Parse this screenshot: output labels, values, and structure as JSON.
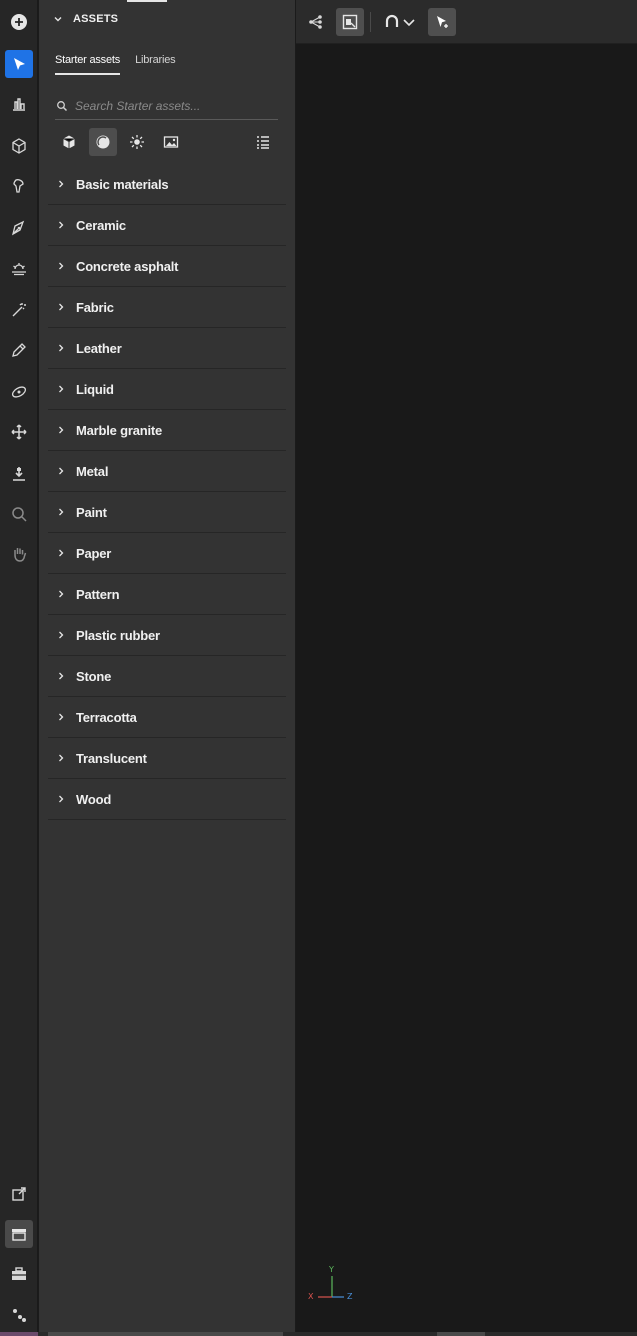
{
  "colors": {
    "accent": "#1f73e6",
    "rail_bg": "#262626",
    "panel_bg": "#333333",
    "viewport_bg": "#191919",
    "axis_x": "#d9534f",
    "axis_y": "#5cb85c",
    "axis_z": "#4a90d9"
  },
  "rail": {
    "tools": [
      {
        "icon": "add-circle-icon"
      },
      {
        "icon": "select-arrow-icon",
        "active": true
      },
      {
        "icon": "chart-bars-icon"
      },
      {
        "icon": "cube-icon"
      },
      {
        "icon": "paint-brush-icon"
      },
      {
        "icon": "pen-tool-icon"
      },
      {
        "icon": "light-horizon-icon"
      },
      {
        "icon": "magic-wand-icon"
      },
      {
        "icon": "eyedropper-icon"
      },
      {
        "icon": "orbit-icon"
      },
      {
        "icon": "move-icon"
      },
      {
        "icon": "drop-to-ground-icon"
      },
      {
        "icon": "zoom-icon"
      },
      {
        "icon": "hand-pan-icon"
      }
    ],
    "bottom_tools": [
      {
        "icon": "export-image-icon"
      },
      {
        "icon": "archive-box-icon",
        "pressed": true
      },
      {
        "icon": "toolbox-icon"
      },
      {
        "icon": "node-graph-icon"
      }
    ]
  },
  "panel": {
    "title": "ASSETS",
    "tabs": [
      {
        "label": "Starter assets",
        "selected": true
      },
      {
        "label": "Libraries",
        "selected": false
      }
    ],
    "search": {
      "placeholder": "Search Starter assets...",
      "value": ""
    },
    "filters": [
      {
        "icon": "model-cube-icon"
      },
      {
        "icon": "material-sphere-icon",
        "pressed": true
      },
      {
        "icon": "light-sun-icon"
      },
      {
        "icon": "image-icon"
      },
      {
        "icon": "list-view-icon"
      }
    ],
    "categories": [
      {
        "label": "Basic materials"
      },
      {
        "label": "Ceramic"
      },
      {
        "label": "Concrete asphalt"
      },
      {
        "label": "Fabric"
      },
      {
        "label": "Leather"
      },
      {
        "label": "Liquid"
      },
      {
        "label": "Marble granite"
      },
      {
        "label": "Metal"
      },
      {
        "label": "Paint"
      },
      {
        "label": "Paper"
      },
      {
        "label": "Pattern"
      },
      {
        "label": "Plastic rubber"
      },
      {
        "label": "Stone"
      },
      {
        "label": "Terracotta"
      },
      {
        "label": "Translucent"
      },
      {
        "label": "Wood"
      }
    ]
  },
  "viewport": {
    "toolbar": [
      {
        "icon": "scene-graph-icon"
      },
      {
        "icon": "frame-selection-icon",
        "pressed": true
      },
      {
        "icon": "magnet-snap-icon"
      },
      {
        "icon": "chevron-down-icon"
      },
      {
        "icon": "sparkle-cursor-icon",
        "pressed": true
      }
    ],
    "gizmo": {
      "x": "X",
      "y": "Y",
      "z": "Z"
    }
  }
}
